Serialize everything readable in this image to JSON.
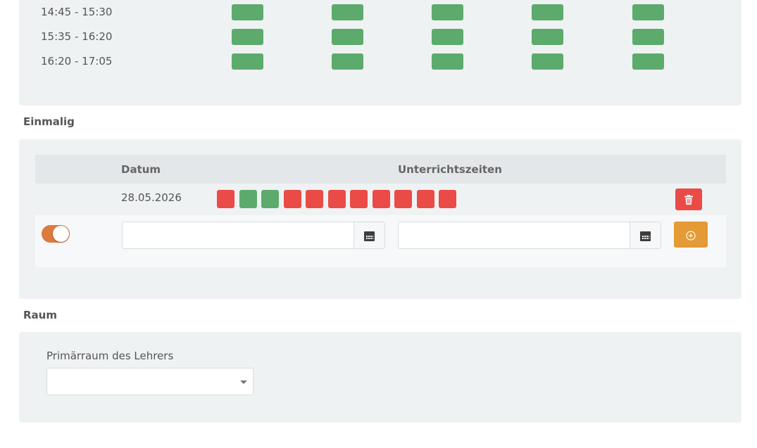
{
  "weekly": {
    "rows": [
      {
        "time": "14:45 - 15:30"
      },
      {
        "time": "15:35 - 16:20"
      },
      {
        "time": "16:20 - 17:05"
      }
    ],
    "slot_color": "#5cab6c"
  },
  "once": {
    "title": "Einmalig",
    "headers": {
      "datum": "Datum",
      "zeiten": "Unterrichtszeiten"
    },
    "entry": {
      "date": "28.05.2026",
      "slots": [
        "red",
        "green",
        "green",
        "red",
        "red",
        "red",
        "red",
        "red",
        "red",
        "red",
        "red"
      ]
    },
    "form": {
      "toggle_on": true,
      "date_from_value": "",
      "date_to_value": ""
    },
    "icons": {
      "delete": "trash-icon",
      "add": "plus-circle-icon",
      "calendar": "calendar-icon"
    }
  },
  "room": {
    "title": "Raum",
    "primary_label": "Primärraum des Lehrers",
    "primary_value": ""
  },
  "colors": {
    "green": "#5cab6c",
    "red": "#ea4b47",
    "orange": "#e49a35",
    "toggle": "#dd7a3e"
  }
}
